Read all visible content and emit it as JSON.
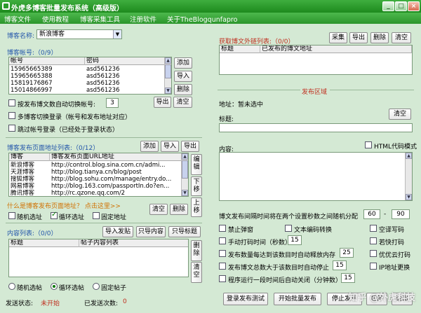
{
  "window": {
    "title": "外虎多博客批量发布系统（高级版）",
    "min": "_",
    "max": "□",
    "close": "×"
  },
  "menu": [
    "博客文件",
    "使用教程",
    "博客采集工具",
    "注册软件",
    "关于TheBlogqunfapro"
  ],
  "blog_name": {
    "label": "博客名称:",
    "value": "新浪博客"
  },
  "accounts": {
    "title": "博客帐号:（0/9）",
    "headers": [
      "帐号",
      "密码"
    ],
    "rows": [
      [
        "15965665389",
        "asd561236"
      ],
      [
        "15965665388",
        "asd561236"
      ],
      [
        "15819176867",
        "asd561236"
      ],
      [
        "15014866997",
        "asd561236"
      ]
    ],
    "add": "添加",
    "import": "导入",
    "delete": "删除",
    "export": "导出",
    "clear": "清空"
  },
  "account_options": {
    "auto_switch": "按发布博文数自动切换帐号:",
    "auto_switch_value": "3",
    "multi_login": "多博客切换登录（帐号和发布地址对应）",
    "skip_login": "跳过帐号登录（已经处于登录状态）"
  },
  "urls": {
    "title": "博客发布页面地址列表:（0/12）",
    "add": "添加",
    "import": "导入",
    "export": "导出",
    "headers": [
      "博客",
      "博客发布页面URL地址"
    ],
    "rows": [
      [
        "新浪博客",
        "http://control.blog.sina.com.cn/admi..."
      ],
      [
        "天涯博客",
        "http://blog.tianya.cn/blog/post"
      ],
      [
        "搜狐博客",
        "http://blog.sohu.com/manage/entry.do..."
      ],
      [
        "网易博客",
        "http://blog.163.com/passportIn.do?en..."
      ],
      [
        "腾讯博客",
        "http://rc.qzone.qq.com/2"
      ]
    ],
    "edit": "编辑",
    "down": "下移",
    "up": "上移"
  },
  "url_help": "什么是博客发布页面地址？ 点击这里>>",
  "url_mode": {
    "random": "随机选址",
    "loop": "循环选址",
    "fixed": "固定地址",
    "clear": "清空",
    "delete": "删除"
  },
  "content": {
    "title": "内容列表:（0/0）",
    "import": "导入发贴",
    "only_content": "只导内容",
    "only_title": "只导标题",
    "headers": [
      "标题",
      "帖子内容列表"
    ],
    "delete": "删除",
    "clear": "清空"
  },
  "post_mode": {
    "random": "随机选帖",
    "loop": "循环选帖",
    "fixed": "固定帖子"
  },
  "status": {
    "send_label": "发送状态:",
    "send_value": "未开始",
    "count_label": "已发送次数:",
    "count_value": "0"
  },
  "links": {
    "title": "获取博文外链列表:（0/0）",
    "collect": "采集",
    "export": "导出",
    "delete": "删除",
    "clear": "清空",
    "headers": [
      "标题",
      "已发布的博文地址"
    ]
  },
  "publish": {
    "section": "发布区域",
    "address": "地址：暂未选中",
    "title_label": "标题:",
    "clear": "清空",
    "content_label": "内容:",
    "html_mode": "HTML代码模式"
  },
  "interval": {
    "label": "博文发布间隔时间将在两个设置秒数之间随机分配",
    "min": "60",
    "sep": "-",
    "max": "90"
  },
  "options": {
    "no_popup": "禁止弹窗",
    "encode": "文本编码转换",
    "space_code": "空译写码",
    "manual": "手动打码时间（秒数）",
    "manual_value": "15",
    "quick_code": "若快打码",
    "pause_label": "发布数量每达到该数目时自动释放内存",
    "pause_value": "25",
    "youyou": "优优云打码",
    "stop_label": "发布博文总数大于该数目时自动停止",
    "stop_value": "15",
    "ip": "IP地址更换",
    "restart_label": "程序运行一段时间后自动关闭（分钟数）",
    "restart_value": "15"
  },
  "actions": {
    "test": "登录发布测试",
    "start": "开始批量发布",
    "stop": "停止发布",
    "pause": "暂停",
    "exit": "退出"
  },
  "watermark": "知乎 @外虎科技"
}
